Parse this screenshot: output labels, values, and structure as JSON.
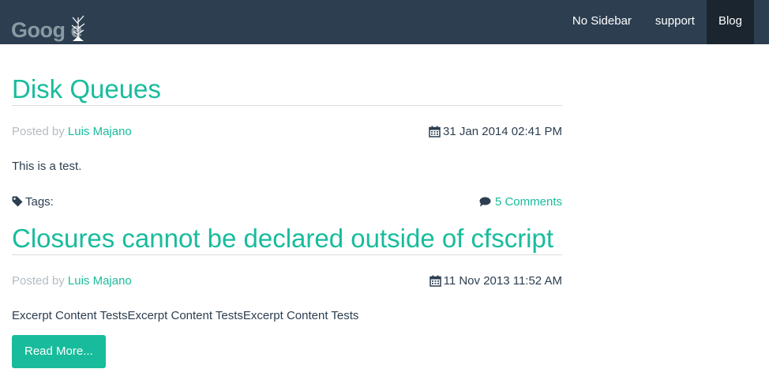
{
  "header": {
    "logo_text": "Goog e",
    "nav": [
      {
        "label": "No Sidebar"
      },
      {
        "label": "support"
      },
      {
        "label": "Blog"
      }
    ]
  },
  "posts": [
    {
      "title": "Disk Queues",
      "posted_by_prefix": "Posted by",
      "author": "Luis Majano",
      "date": "31 Jan 2014 02:41 PM",
      "excerpt": "This is a test.",
      "tags_label": "Tags:",
      "comments": "5 Comments"
    },
    {
      "title": "Closures cannot be declared outside of cfscript",
      "posted_by_prefix": "Posted by",
      "author": "Luis Majano",
      "date": "11 Nov 2013 11:52 AM",
      "excerpt": "Excerpt Content TestsExcerpt Content TestsExcerpt Content Tests",
      "read_more": "Read More..."
    }
  ],
  "colors": {
    "navbar": "#2c3e50",
    "accent": "#18bc9c",
    "active_nav": "#1a252f"
  },
  "icons": [
    "calendar-icon",
    "tag-icon",
    "comment-icon",
    "logo-tree-icon"
  ]
}
